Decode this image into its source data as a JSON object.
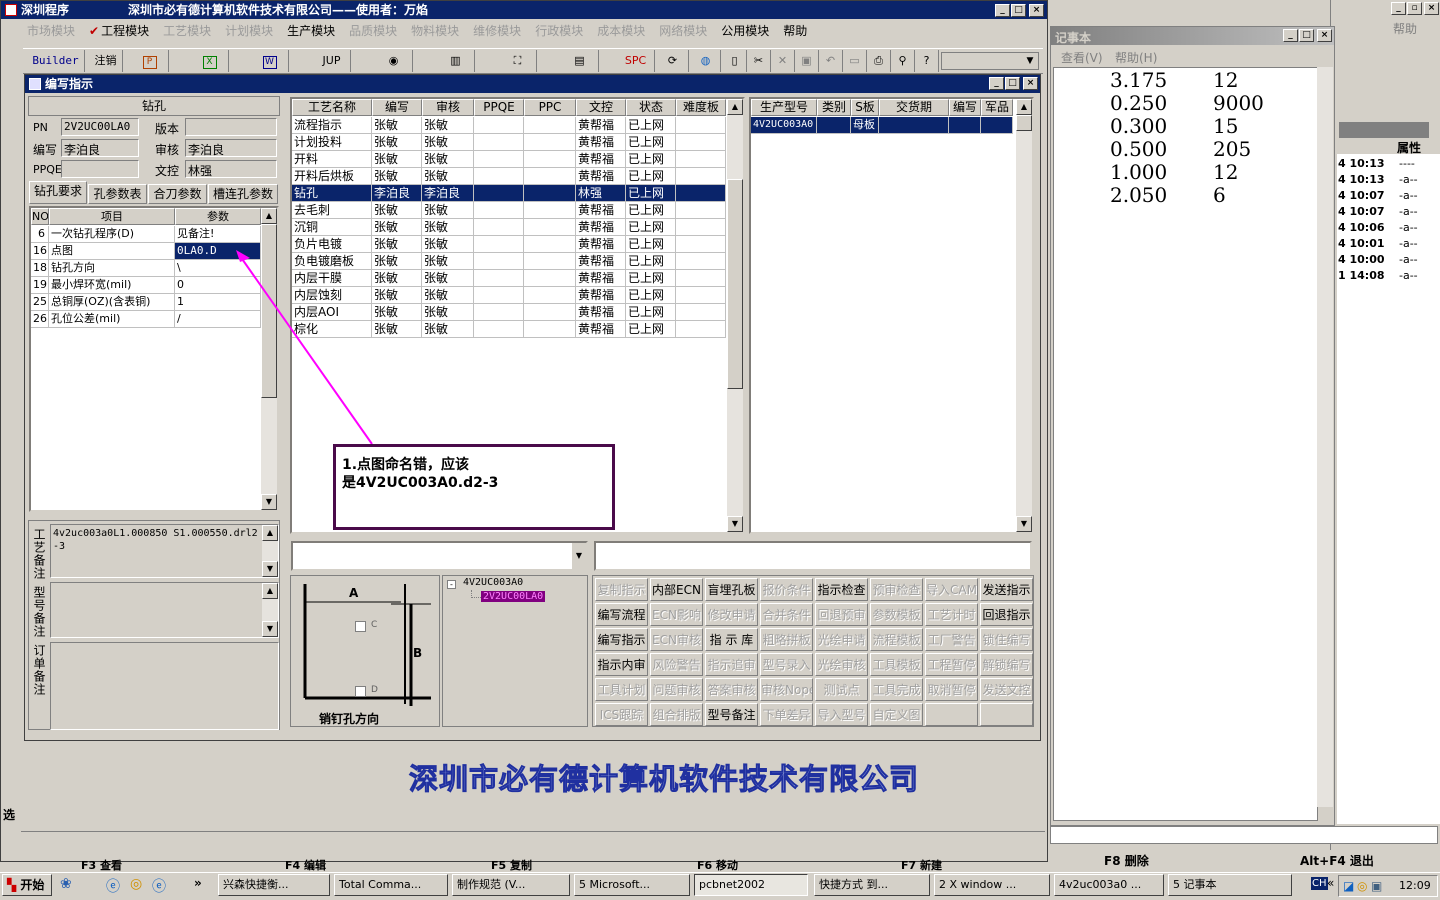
{
  "main_window": {
    "title_app": "深圳程序",
    "title_company": "深圳市必有德计算机软件技术有限公司——使用者：万焰",
    "menu": [
      {
        "label": "市场模块",
        "enabled": false
      },
      {
        "label": "工程模块",
        "enabled": true,
        "checked": true
      },
      {
        "label": "工艺模块",
        "enabled": false
      },
      {
        "label": "计划模块",
        "enabled": false
      },
      {
        "label": "生产模块",
        "enabled": true
      },
      {
        "label": "品质模块",
        "enabled": false
      },
      {
        "label": "物料模块",
        "enabled": false
      },
      {
        "label": "维修模块",
        "enabled": false
      },
      {
        "label": "行政模块",
        "enabled": false
      },
      {
        "label": "成本模块",
        "enabled": false
      },
      {
        "label": "网络模块",
        "enabled": false
      },
      {
        "label": "公用模块",
        "enabled": true
      },
      {
        "label": "帮助",
        "enabled": true
      }
    ],
    "toolbar": {
      "builder": "Builder",
      "logout": "注销",
      "jup": "JUP",
      "spc": "SPC"
    },
    "footer_logo": "深圳市必有德计算机软件技术有限公司",
    "fkeys": [
      "F3 查看",
      "F4 编辑",
      "F5 复制",
      "F6 移动",
      "F7 新建"
    ]
  },
  "editor": {
    "title": "编写指示",
    "section_title": "钻孔",
    "fields": {
      "pn_label": "PN",
      "pn_value": "2V2UC00LA0",
      "version_label": "版本",
      "version_value": "",
      "writer_label": "编写",
      "writer_value": "李泊良",
      "reviewer_label": "审核",
      "reviewer_value": "李泊良",
      "ppqe_label": "PPQE",
      "ppqe_value": "",
      "control_label": "文控",
      "control_value": "林强"
    },
    "tabs": [
      "钻孔要求",
      "孔参数表",
      "合刀参数",
      "槽连孔参数"
    ],
    "param_headers": [
      "NO",
      "项目",
      "参数"
    ],
    "params": [
      {
        "no": "6",
        "item": "一次钻孔程序(D)",
        "value": "见备注!"
      },
      {
        "no": "16",
        "item": "点图",
        "value": "0LA0.D"
      },
      {
        "no": "18",
        "item": "钻孔方向",
        "value": "\\"
      },
      {
        "no": "19",
        "item": "最小焊环宽(mil)",
        "value": "0"
      },
      {
        "no": "25",
        "item": "总铜厚(OZ)(含表铜)",
        "value": "1"
      },
      {
        "no": "26",
        "item": "孔位公差(mil)",
        "value": "/"
      }
    ],
    "remarks": {
      "process_label": "工艺备注",
      "process_text": "4v2uc003a0L1.000850 S1.000550.drl2-3",
      "model_label": "型号备注",
      "order_label": "订单备注"
    },
    "process_headers": [
      "工艺名称",
      "编写",
      "审核",
      "PPQE",
      "PPC",
      "文控",
      "状态",
      "难度板"
    ],
    "processes": [
      {
        "name": "流程指示",
        "writer": "张敏",
        "reviewer": "张敏",
        "ppqe": "",
        "ppc": "",
        "control": "黄帮福",
        "status": "已上网"
      },
      {
        "name": "计划投料",
        "writer": "张敏",
        "reviewer": "张敏",
        "ppqe": "",
        "ppc": "",
        "control": "黄帮福",
        "status": "已上网"
      },
      {
        "name": "开料",
        "writer": "张敏",
        "reviewer": "张敏",
        "ppqe": "",
        "ppc": "",
        "control": "黄帮福",
        "status": "已上网"
      },
      {
        "name": "开料后烘板",
        "writer": "张敏",
        "reviewer": "张敏",
        "ppqe": "",
        "ppc": "",
        "control": "黄帮福",
        "status": "已上网"
      },
      {
        "name": "钻孔",
        "writer": "李泊良",
        "reviewer": "李泊良",
        "ppqe": "",
        "ppc": "",
        "control": "林强",
        "status": "已上网"
      },
      {
        "name": "去毛刺",
        "writer": "张敏",
        "reviewer": "张敏",
        "ppqe": "",
        "ppc": "",
        "control": "黄帮福",
        "status": "已上网"
      },
      {
        "name": "沉铜",
        "writer": "张敏",
        "reviewer": "张敏",
        "ppqe": "",
        "ppc": "",
        "control": "黄帮福",
        "status": "已上网"
      },
      {
        "name": "负片电镀",
        "writer": "张敏",
        "reviewer": "张敏",
        "ppqe": "",
        "ppc": "",
        "control": "黄帮福",
        "status": "已上网"
      },
      {
        "name": "负电镀磨板",
        "writer": "张敏",
        "reviewer": "张敏",
        "ppqe": "",
        "ppc": "",
        "control": "黄帮福",
        "status": "已上网"
      },
      {
        "name": "内层干膜",
        "writer": "张敏",
        "reviewer": "张敏",
        "ppqe": "",
        "ppc": "",
        "control": "黄帮福",
        "status": "已上网"
      },
      {
        "name": "内层蚀刻",
        "writer": "张敏",
        "reviewer": "张敏",
        "ppqe": "",
        "ppc": "",
        "control": "黄帮福",
        "status": "已上网"
      },
      {
        "name": "内层AOI",
        "writer": "张敏",
        "reviewer": "张敏",
        "ppqe": "",
        "ppc": "",
        "control": "黄帮福",
        "status": "已上网"
      },
      {
        "name": "棕化",
        "writer": "张敏",
        "reviewer": "张敏",
        "ppqe": "",
        "ppc": "",
        "control": "黄帮福",
        "status": "已上网"
      }
    ],
    "model_headers": [
      "生产型号",
      "类别",
      "S板",
      "交货期",
      "编写",
      "军品"
    ],
    "models": [
      {
        "model": "4V2UC003A0",
        "type": "",
        "s": "母板",
        "date": "",
        "writer": "",
        "mil": ""
      }
    ],
    "diagram": {
      "a": "A",
      "b": "B",
      "c": "C",
      "d": "D",
      "caption": "销钉孔方向"
    },
    "tree": {
      "root": "4V2UC003A0",
      "child": "2V2UC00LA0"
    },
    "buttons": [
      {
        "label": "复制指示",
        "enabled": false
      },
      {
        "label": "内部ECN",
        "enabled": true
      },
      {
        "label": "盲埋孔板",
        "enabled": true
      },
      {
        "label": "报价条件",
        "enabled": false
      },
      {
        "label": "指示检查",
        "enabled": true
      },
      {
        "label": "预审检查",
        "enabled": false
      },
      {
        "label": "导入CAM",
        "enabled": false
      },
      {
        "label": "发送指示",
        "enabled": true
      },
      {
        "label": "编写流程",
        "enabled": true
      },
      {
        "label": "ECN影响",
        "enabled": false
      },
      {
        "label": "修改申请",
        "enabled": false
      },
      {
        "label": "合并条件",
        "enabled": false
      },
      {
        "label": "回退预审",
        "enabled": false
      },
      {
        "label": "参数模板",
        "enabled": false
      },
      {
        "label": "工艺计时",
        "enabled": false
      },
      {
        "label": "回退指示",
        "enabled": true
      },
      {
        "label": "编写指示",
        "enabled": true
      },
      {
        "label": "ECN审核",
        "enabled": false
      },
      {
        "label": "指 示 库",
        "enabled": true
      },
      {
        "label": "粗略拼板",
        "enabled": false
      },
      {
        "label": "光绘申请",
        "enabled": false
      },
      {
        "label": "流程模板",
        "enabled": false
      },
      {
        "label": "工厂警告",
        "enabled": false
      },
      {
        "label": "锁住编写",
        "enabled": false
      },
      {
        "label": "指示内审",
        "enabled": true
      },
      {
        "label": "风险警告",
        "enabled": false
      },
      {
        "label": "指示追审",
        "enabled": false
      },
      {
        "label": "型号录入",
        "enabled": false
      },
      {
        "label": "光绘审核",
        "enabled": false
      },
      {
        "label": "工具模板",
        "enabled": false
      },
      {
        "label": "工程暂停",
        "enabled": false
      },
      {
        "label": "解锁编写",
        "enabled": false
      },
      {
        "label": "工具计划",
        "enabled": false
      },
      {
        "label": "问题审核",
        "enabled": false
      },
      {
        "label": "答案审核",
        "enabled": false
      },
      {
        "label": "审核Nope",
        "enabled": false
      },
      {
        "label": "测试点",
        "enabled": false
      },
      {
        "label": "工具完成",
        "enabled": false
      },
      {
        "label": "取消暂停",
        "enabled": false
      },
      {
        "label": "发送文控",
        "enabled": false
      },
      {
        "label": "ICS跟踪",
        "enabled": false
      },
      {
        "label": "组合排版",
        "enabled": false
      },
      {
        "label": "型号备注",
        "enabled": true
      },
      {
        "label": "下单差异",
        "enabled": false
      },
      {
        "label": "导入型号",
        "enabled": false
      },
      {
        "label": "自定义图",
        "enabled": false
      },
      {
        "label": "",
        "enabled": false
      },
      {
        "label": "",
        "enabled": false
      }
    ]
  },
  "callout": {
    "line1": "1.点图命名错，应该",
    "line2": "是4V2UC003A0.d2-3"
  },
  "notepad": {
    "title": "记事本",
    "menu": [
      "查看(V)",
      "帮助(H)"
    ],
    "lines": [
      {
        "a": "3.175",
        "b": "12"
      },
      {
        "a": "0.250",
        "b": "9000"
      },
      {
        "a": "0.300",
        "b": "15"
      },
      {
        "a": "0.500",
        "b": "205"
      },
      {
        "a": "1.000",
        "b": "12"
      },
      {
        "a": "2.050",
        "b": "6"
      }
    ]
  },
  "filemanager": {
    "help": "帮助",
    "attr_header": "属性",
    "rows": [
      {
        "time": "4 10:13",
        "attr": "----"
      },
      {
        "time": "4 10:13",
        "attr": "-a--"
      },
      {
        "time": "4 10:07",
        "attr": "-a--"
      },
      {
        "time": "4 10:07",
        "attr": "-a--"
      },
      {
        "time": "4 10:06",
        "attr": "-a--"
      },
      {
        "time": "4 10:01",
        "attr": "-a--"
      },
      {
        "time": "4 10:00",
        "attr": "-a--"
      },
      {
        "time": "1 14:08",
        "attr": "-a--"
      }
    ],
    "f8": "F8 删除",
    "altf4": "Alt+F4 退出"
  },
  "taskbar": {
    "start": "开始",
    "tasks": [
      "兴森快捷衡...",
      "Total Comma...",
      "制作规范 (V...",
      "5 Microsoft...",
      "pcbnet2002",
      "快捷方式 到...",
      "2 X window ...",
      "4v2uc003a0 ...",
      "5 记事本"
    ],
    "clock": "12:09",
    "ime": "CH"
  },
  "colors": {
    "titlebar": "#0a246a",
    "selection": "#0a246a",
    "callout_border": "#4a0a4a",
    "arrow": "#ff00ff",
    "tree_selected": "#800080"
  }
}
